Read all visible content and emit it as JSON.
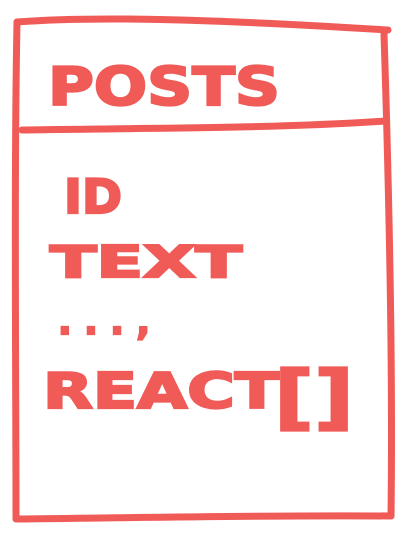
{
  "entity": {
    "title": "POSTS",
    "fields": [
      "ID",
      "TEXT",
      ". . . ,",
      "REACT"
    ],
    "array_suffix": "[]"
  },
  "colors": {
    "ink": "#f05a57",
    "background": "#ffffff"
  }
}
